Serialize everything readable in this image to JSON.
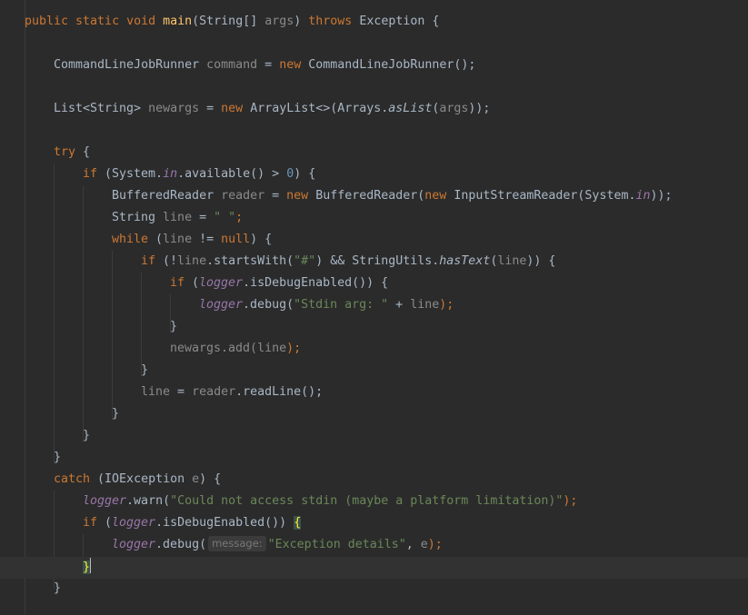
{
  "colors": {
    "background": "#2b2b2b",
    "keyword": "#cc7832",
    "method_declaration": "#ffc66d",
    "plain": "#a9b7c6",
    "field": "#9876aa",
    "string": "#6a8759",
    "number": "#6897bb",
    "parameter": "#8a8a8a",
    "brace_match": "#ffef28"
  },
  "code": {
    "main_sig": {
      "mods": "public static void",
      "name": "main",
      "p1": "(String[] ",
      "args": "args",
      "p2": ") ",
      "throws": "throws",
      "tail": " Exception {"
    },
    "l2": {
      "type": "CommandLineJobRunner ",
      "var": "command",
      "eq": " = ",
      "new": "new",
      "tail": " CommandLineJobRunner();"
    },
    "l3": {
      "type": "List<String> ",
      "var": "newargs",
      "eq": " = ",
      "new": "new",
      "mid": " ArrayList<>(Arrays.",
      "method": "asList",
      "open": "(",
      "args": "args",
      "tail": "));"
    },
    "l4": {
      "kw": "try",
      "tail": " {"
    },
    "l5": {
      "kw": "if",
      "a": " (System.",
      "field": "in",
      "b": ".available() > ",
      "num": "0",
      "c": ") {"
    },
    "l6": {
      "type": "BufferedReader ",
      "var": "reader",
      "eq": " = ",
      "new1": "new",
      "mid": " BufferedReader(",
      "new2": "new",
      "mid2": " InputStreamReader(System.",
      "field": "in",
      "tail": "));"
    },
    "l7": {
      "type": "String ",
      "var": "line",
      "eq": " = ",
      "str": "\" \"",
      "tail": ";"
    },
    "l8": {
      "kw": "while",
      "a": " (",
      "var": "line",
      "b": " != ",
      "null": "null",
      "c": ") {"
    },
    "l9": {
      "kw": "if",
      "a": " (!",
      "var": "line",
      "b": ".startsWith(",
      "str": "\"#\"",
      "c": ") && StringUtils.",
      "method": "hasText",
      "d": "(",
      "var2": "line",
      "e": ")) {"
    },
    "l10": {
      "kw": "if",
      "a": " (",
      "field": "logger",
      "b": ".isDebugEnabled()) {"
    },
    "l11": {
      "field": "logger",
      "a": ".debug(",
      "str": "\"Stdin arg: \"",
      "b": " + ",
      "var": "line",
      "c": ");"
    },
    "l12": "}",
    "l13": {
      "a": "newargs.add(",
      "var": "line",
      "b": ");"
    },
    "l14": "}",
    "l15": {
      "var": "line",
      "eq": " = ",
      "var2": "reader",
      "tail": ".readLine();"
    },
    "l16": "}",
    "l17": "}",
    "l18": "}",
    "l19": {
      "kw": "catch",
      "a": " (IOException ",
      "var": "e",
      "b": ") {"
    },
    "l20": {
      "field": "logger",
      "a": ".warn(",
      "str": "\"Could not access stdin (maybe a platform limitation)\"",
      "b": ");"
    },
    "l21": {
      "kw": "if",
      "a": " (",
      "field": "logger",
      "b": ".isDebugEnabled()) ",
      "brace": "{"
    },
    "l22": {
      "field": "logger",
      "a": ".debug(",
      "hint": "message:",
      "str": "\"Exception details\"",
      "b": ", ",
      "var": "e",
      "c": ");"
    },
    "l23": {
      "brace": "}"
    },
    "l24": "}"
  }
}
